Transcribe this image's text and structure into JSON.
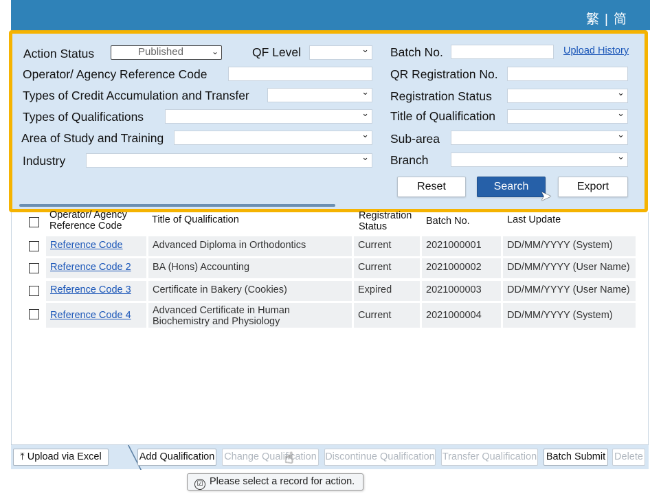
{
  "header": {
    "lang_traditional": "繁",
    "separator": "|",
    "lang_simplified": "简"
  },
  "filters": {
    "action_status": {
      "label": "Action Status",
      "value": "Published"
    },
    "qf_level": {
      "label": "QF Level",
      "value": ""
    },
    "batch_no": {
      "label": "Batch No.",
      "value": ""
    },
    "upload_history": "Upload History",
    "operator_ref": {
      "label": "Operator/ Agency Reference Code",
      "value": ""
    },
    "qr_reg_no": {
      "label": "QR Registration No.",
      "value": ""
    },
    "credit_types": {
      "label": "Types of Credit Accumulation and Transfer",
      "value": ""
    },
    "reg_status": {
      "label": "Registration Status",
      "value": ""
    },
    "qual_types": {
      "label": "Types of Qualifications",
      "value": ""
    },
    "qual_title": {
      "label": "Title of Qualification",
      "value": ""
    },
    "area": {
      "label": "Area of Study and Training",
      "value": ""
    },
    "sub_area": {
      "label": "Sub-area",
      "value": ""
    },
    "industry": {
      "label": "Industry",
      "value": ""
    },
    "branch": {
      "label": "Branch",
      "value": ""
    },
    "reset": "Reset",
    "search": "Search",
    "export": "Export"
  },
  "table": {
    "headers": {
      "ref_line1": "Operator/ Agency",
      "ref_line2": "Reference Code",
      "title": "Title of Qualification",
      "status_line1": "Registration",
      "status_line2": "Status",
      "batch": "Batch No.",
      "update": "Last Update"
    },
    "rows": [
      {
        "ref": "Reference Code",
        "title": "Advanced Diploma in Orthodontics",
        "title_line2": "",
        "status": "Current",
        "batch": "2021000001",
        "update": "DD/MM/YYYY (System)"
      },
      {
        "ref": "Reference Code 2",
        "title": "BA (Hons) Accounting",
        "title_line2": "",
        "status": "Current",
        "batch": "2021000002",
        "update": "DD/MM/YYYY (User Name)"
      },
      {
        "ref": "Reference Code 3",
        "title": "Certificate in Bakery (Cookies)",
        "title_line2": "",
        "status": "Expired",
        "batch": "2021000003",
        "update": "DD/MM/YYYY (User Name)"
      },
      {
        "ref": "Reference Code 4",
        "title": "Advanced Certificate in Human",
        "title_line2": "Biochemistry and Physiology",
        "status": "Current",
        "batch": "2021000004",
        "update": "DD/MM/YYYY (System)"
      }
    ]
  },
  "actions": {
    "upload_excel": "Upload via Excel",
    "add": "Add Qualification",
    "change": "Change Qualification",
    "discontinue": "Discontinue Qualification",
    "transfer": "Transfer Qualification",
    "batch_submit": "Batch Submit",
    "delete": "Delete"
  },
  "tooltip": "Please select a record for action.",
  "colors": {
    "accent": "#2f82b8",
    "highlight_border": "#f5b301",
    "primary_button": "#2660a8",
    "link": "#1a56b8"
  }
}
